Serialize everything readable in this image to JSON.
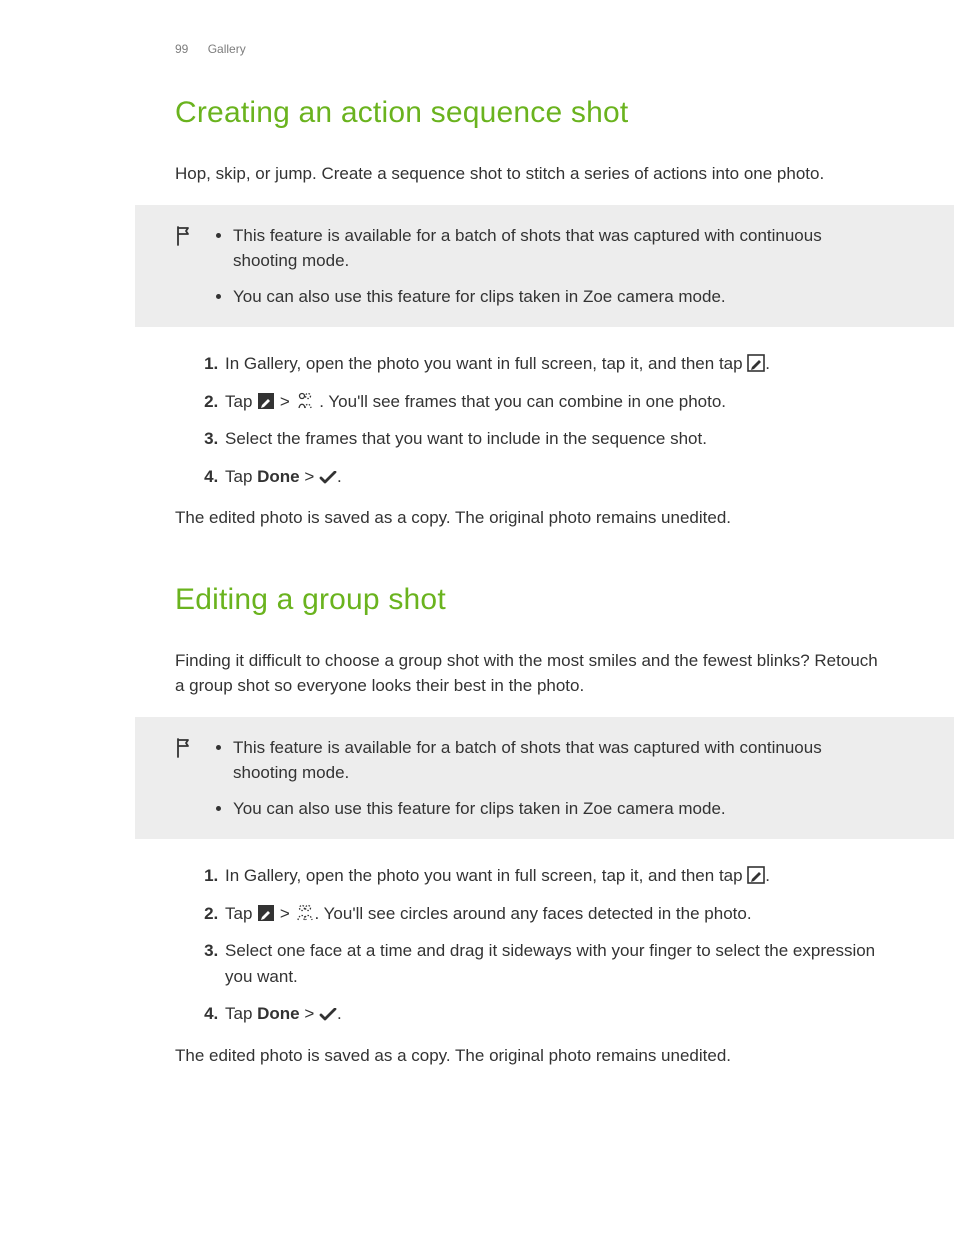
{
  "header": {
    "pageNumber": "99",
    "section": "Gallery"
  },
  "s1": {
    "title": "Creating an action sequence shot",
    "intro": "Hop, skip, or jump. Create a sequence shot to stitch a series of actions into one photo.",
    "note1": "This feature is available for a batch of shots that was captured with continuous shooting mode.",
    "note2": "You can also use this feature for clips taken in Zoe camera mode.",
    "step1a": "In Gallery, open the photo you want in full screen, tap it, and then tap ",
    "step1b": ".",
    "step2a": "Tap ",
    "step2b": " > ",
    "step2c": " . You'll see frames that you can combine in one photo.",
    "step3": "Select the frames that you want to include in the sequence shot.",
    "step4a": "Tap ",
    "step4done": "Done",
    "step4b": " > ",
    "step4c": ".",
    "outro": "The edited photo is saved as a copy. The original photo remains unedited."
  },
  "s2": {
    "title": "Editing a group shot",
    "intro": "Finding it difficult to choose a group shot with the most smiles and the fewest blinks? Retouch a group shot so everyone looks their best in the photo.",
    "note1": "This feature is available for a batch of shots that was captured with continuous shooting mode.",
    "note2": "You can also use this feature for clips taken in Zoe camera mode.",
    "step1a": "In Gallery, open the photo you want in full screen, tap it, and then tap ",
    "step1b": ".",
    "step2a": "Tap ",
    "step2b": " > ",
    "step2c": ". You'll see circles around any faces detected in the photo.",
    "step3": "Select one face at a time and drag it sideways with your finger to select the expression you want.",
    "step4a": "Tap ",
    "step4done": "Done",
    "step4b": " > ",
    "step4c": ".",
    "outro": "The edited photo is saved as a copy. The original photo remains unedited."
  }
}
